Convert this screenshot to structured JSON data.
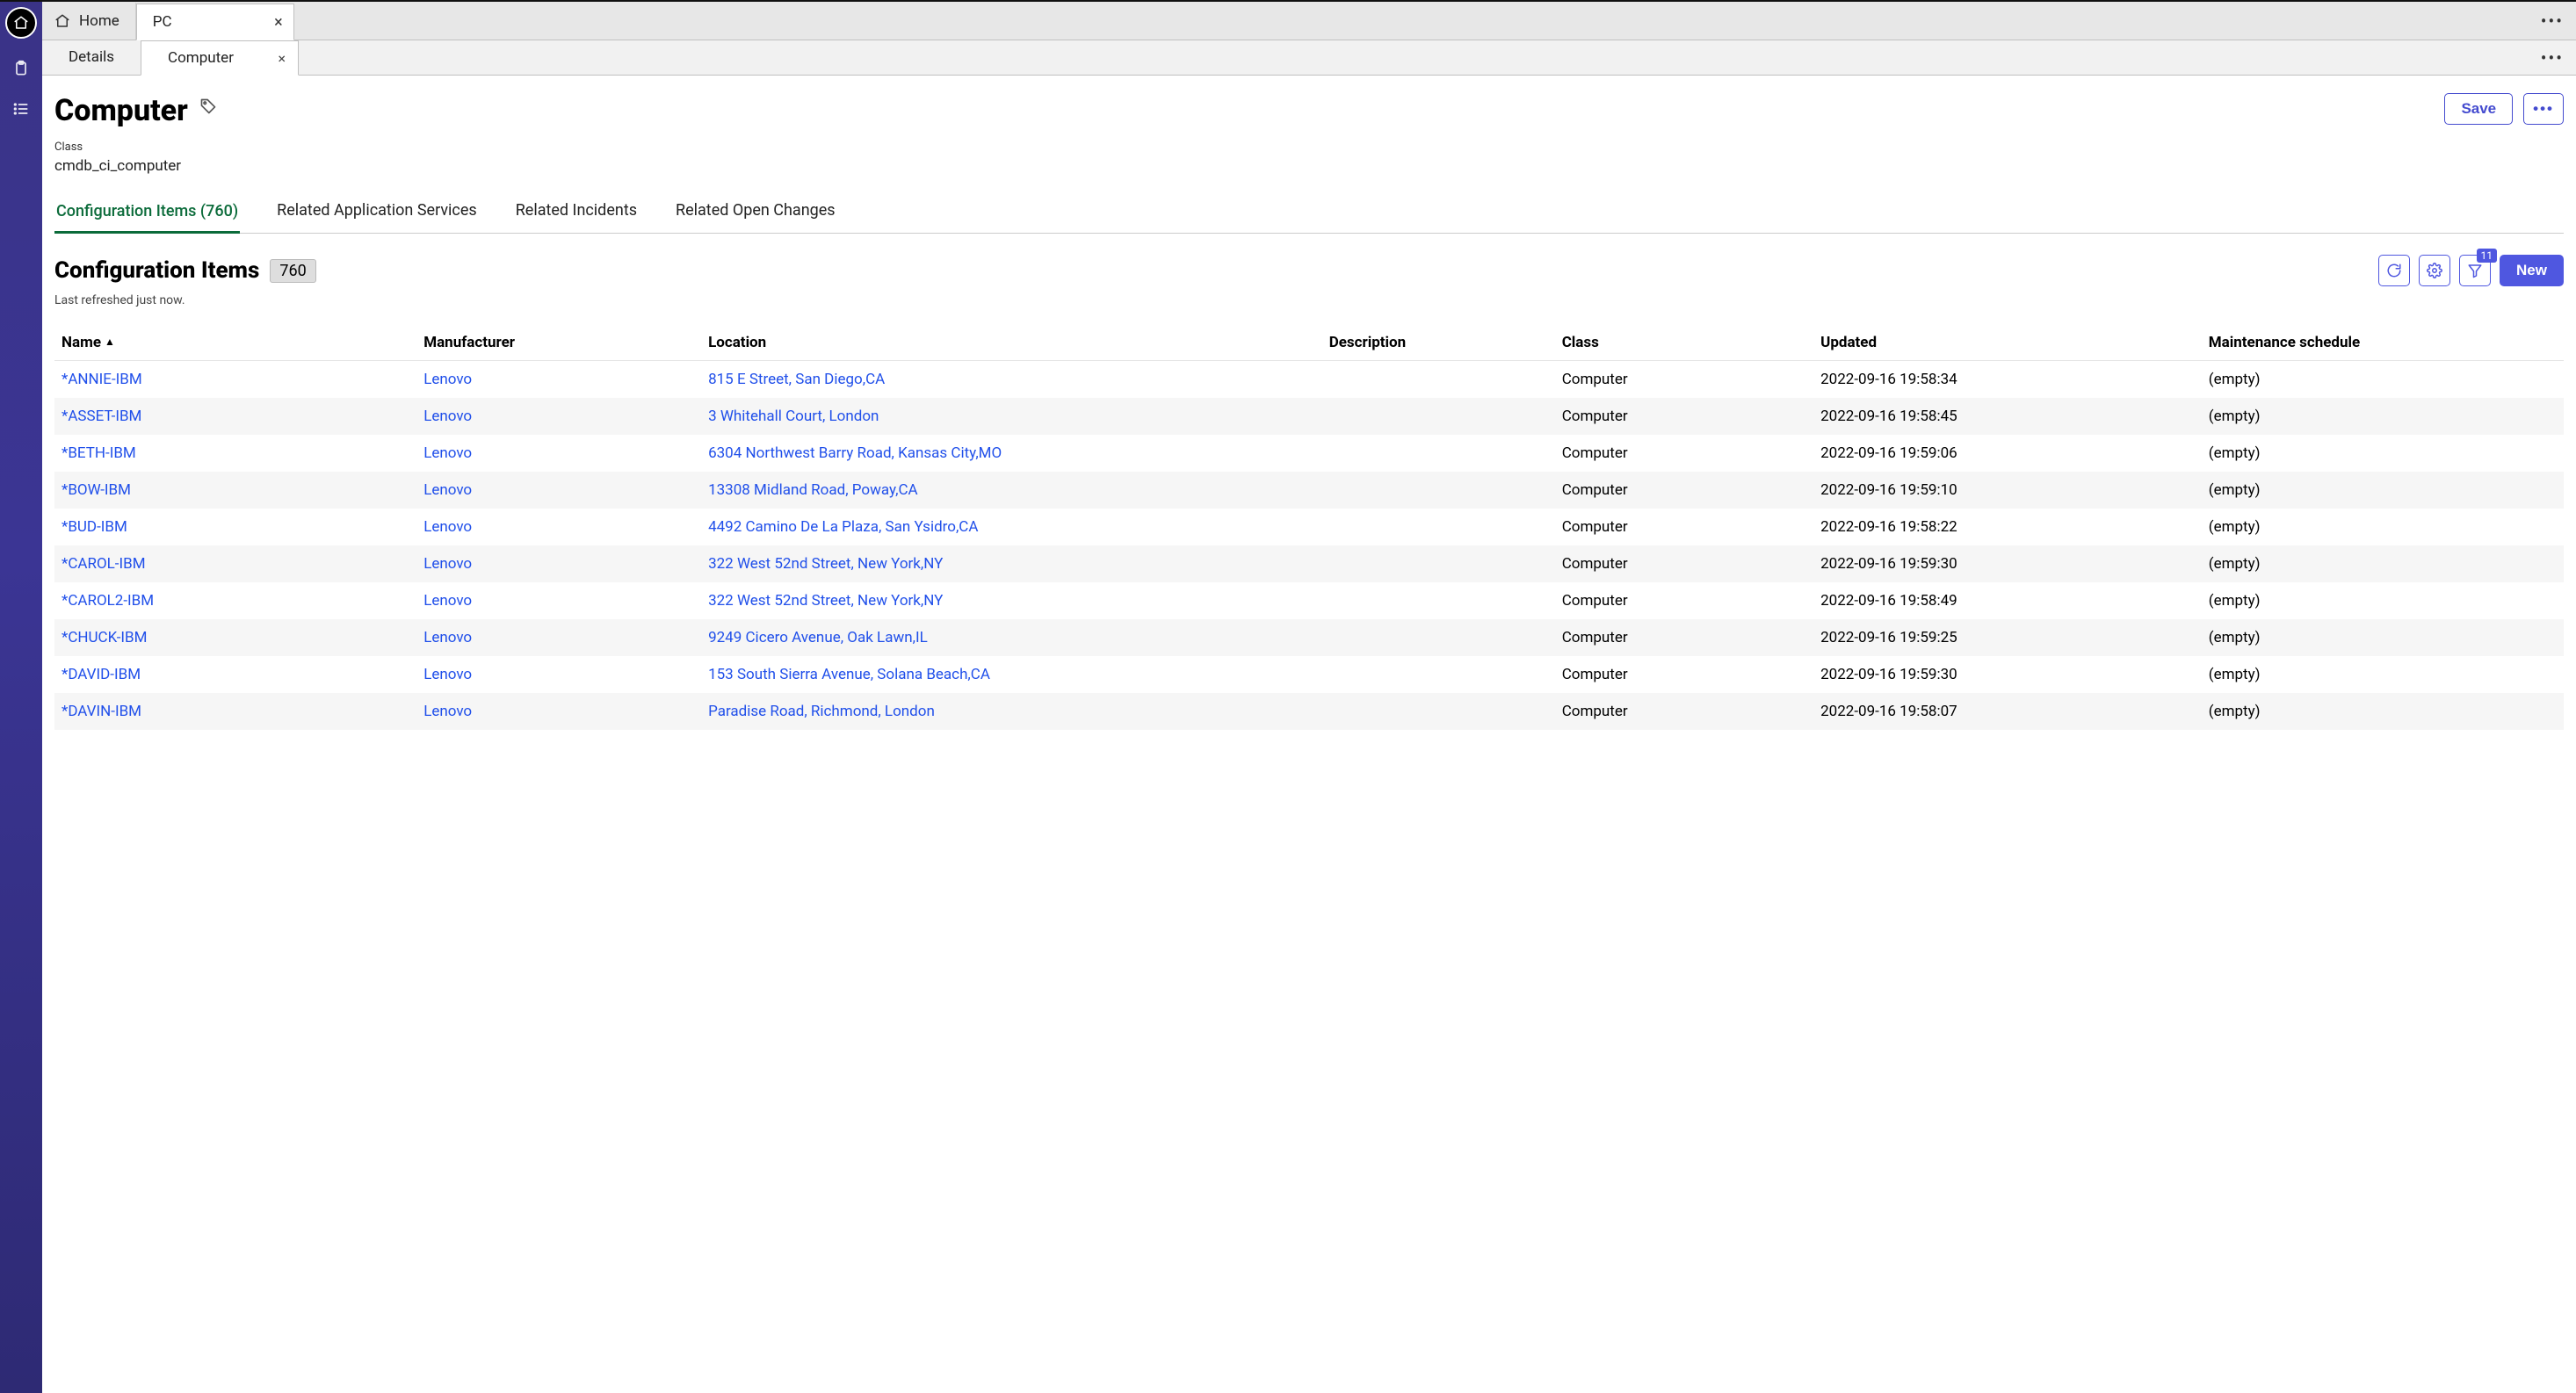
{
  "toptabs": {
    "home": "Home",
    "pc": "PC",
    "more": "•••"
  },
  "subtabs": {
    "details": "Details",
    "computer": "Computer",
    "more": "•••"
  },
  "header": {
    "title": "Computer",
    "class_label": "Class",
    "class_value": "cmdb_ci_computer",
    "save": "Save",
    "more": "•••"
  },
  "formtabs": {
    "tab0": "Configuration Items (760)",
    "tab1": "Related Application Services",
    "tab2": "Related Incidents",
    "tab3": "Related Open Changes"
  },
  "list": {
    "title": "Configuration Items",
    "count": "760",
    "refreshed": "Last refreshed just now.",
    "filter_badge": "11",
    "new_btn": "New",
    "columns": {
      "name": "Name",
      "manufacturer": "Manufacturer",
      "location": "Location",
      "description": "Description",
      "class": "Class",
      "updated": "Updated",
      "maintenance": "Maintenance schedule"
    },
    "rows": [
      {
        "name": "*ANNIE-IBM",
        "manufacturer": "Lenovo",
        "location": "815 E Street, San Diego,CA",
        "description": "",
        "class": "Computer",
        "updated": "2022-09-16 19:58:34",
        "maintenance": "(empty)"
      },
      {
        "name": "*ASSET-IBM",
        "manufacturer": "Lenovo",
        "location": "3 Whitehall Court, London",
        "description": "",
        "class": "Computer",
        "updated": "2022-09-16 19:58:45",
        "maintenance": "(empty)"
      },
      {
        "name": "*BETH-IBM",
        "manufacturer": "Lenovo",
        "location": "6304 Northwest Barry Road, Kansas City,MO",
        "description": "",
        "class": "Computer",
        "updated": "2022-09-16 19:59:06",
        "maintenance": "(empty)"
      },
      {
        "name": "*BOW-IBM",
        "manufacturer": "Lenovo",
        "location": "13308 Midland Road, Poway,CA",
        "description": "",
        "class": "Computer",
        "updated": "2022-09-16 19:59:10",
        "maintenance": "(empty)"
      },
      {
        "name": "*BUD-IBM",
        "manufacturer": "Lenovo",
        "location": "4492 Camino De La Plaza, San Ysidro,CA",
        "description": "",
        "class": "Computer",
        "updated": "2022-09-16 19:58:22",
        "maintenance": "(empty)"
      },
      {
        "name": "*CAROL-IBM",
        "manufacturer": "Lenovo",
        "location": "322 West 52nd Street, New York,NY",
        "description": "",
        "class": "Computer",
        "updated": "2022-09-16 19:59:30",
        "maintenance": "(empty)"
      },
      {
        "name": "*CAROL2-IBM",
        "manufacturer": "Lenovo",
        "location": "322 West 52nd Street, New York,NY",
        "description": "",
        "class": "Computer",
        "updated": "2022-09-16 19:58:49",
        "maintenance": "(empty)"
      },
      {
        "name": "*CHUCK-IBM",
        "manufacturer": "Lenovo",
        "location": "9249 Cicero Avenue, Oak Lawn,IL",
        "description": "",
        "class": "Computer",
        "updated": "2022-09-16 19:59:25",
        "maintenance": "(empty)"
      },
      {
        "name": "*DAVID-IBM",
        "manufacturer": "Lenovo",
        "location": "153 South Sierra Avenue, Solana Beach,CA",
        "description": "",
        "class": "Computer",
        "updated": "2022-09-16 19:59:30",
        "maintenance": "(empty)"
      },
      {
        "name": "*DAVIN-IBM",
        "manufacturer": "Lenovo",
        "location": "Paradise Road, Richmond, London",
        "description": "",
        "class": "Computer",
        "updated": "2022-09-16 19:58:07",
        "maintenance": "(empty)"
      }
    ]
  }
}
